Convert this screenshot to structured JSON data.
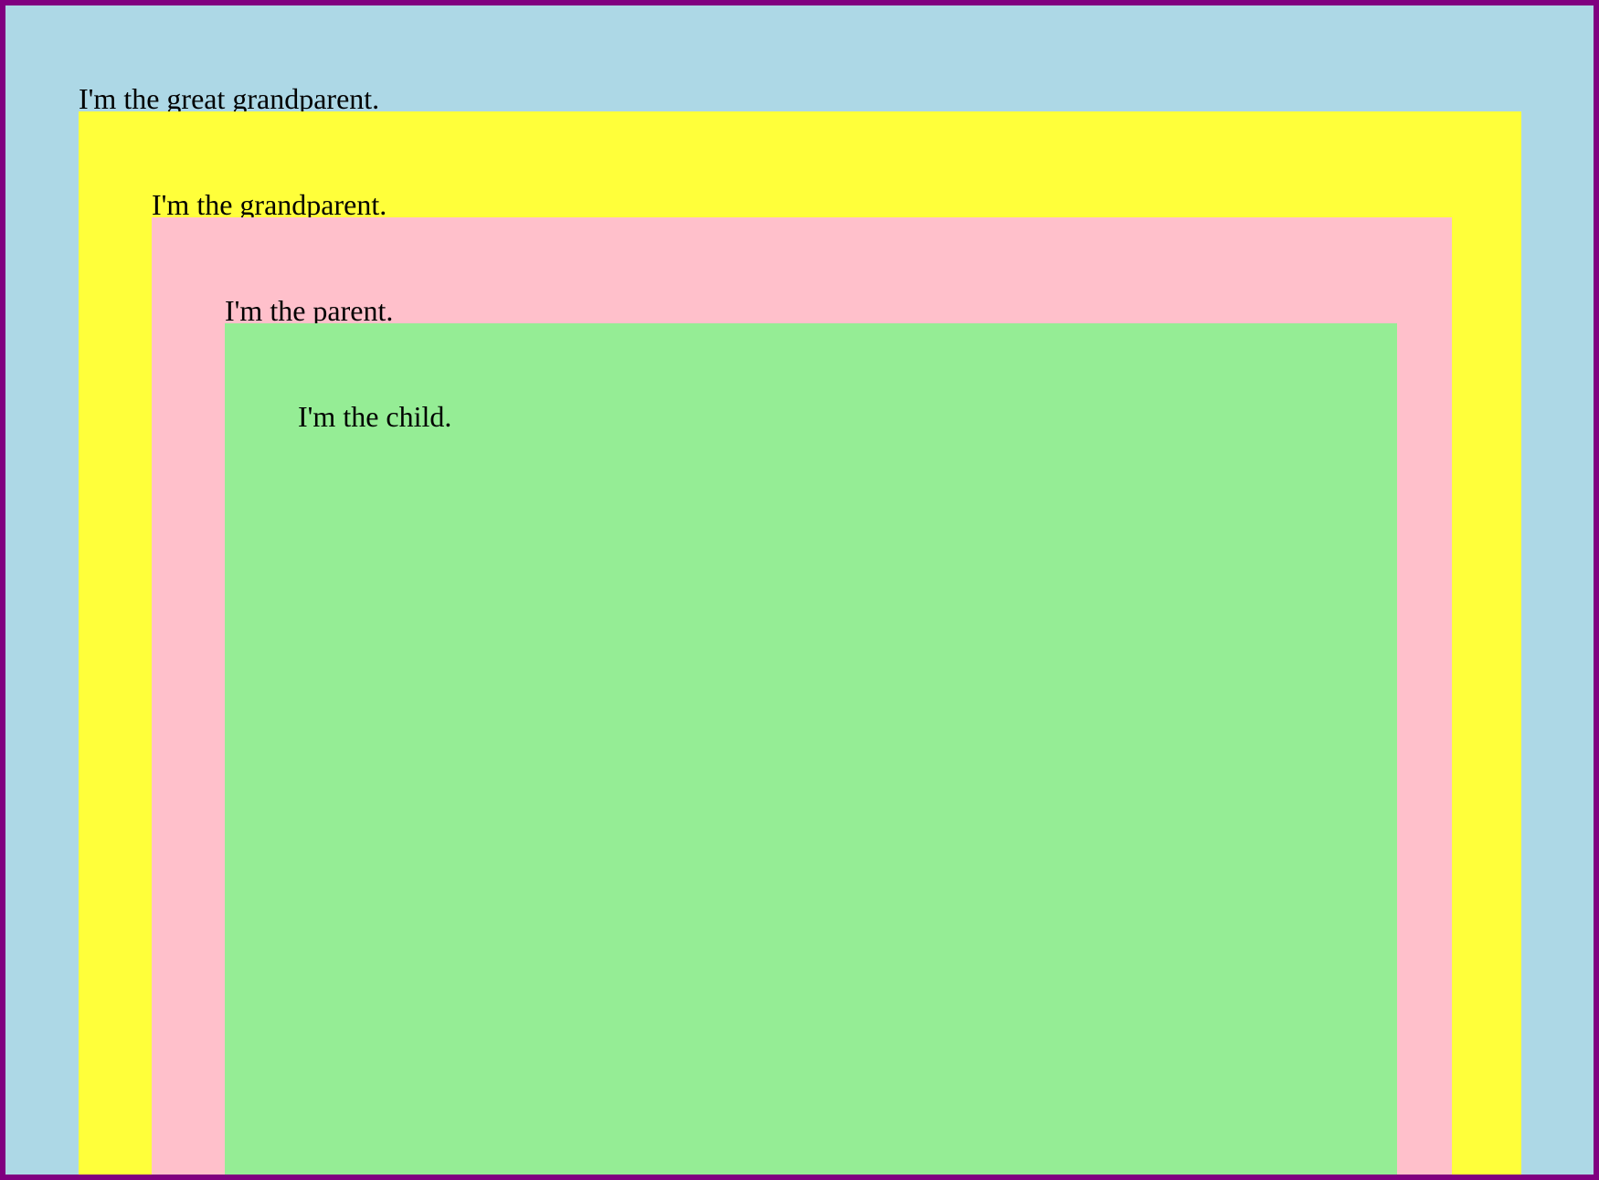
{
  "colors": {
    "frame_border": "#800080",
    "great_grandparent_bg": "#add8e6",
    "grandparent_bg": "#ffff3a",
    "parent_bg": "#ffc0cb",
    "child_bg": "#95ed95"
  },
  "labels": {
    "great_grandparent": "I'm the great grandparent.",
    "grandparent": "I'm the grandparent.",
    "parent": "I'm the parent.",
    "child": "I'm the child."
  }
}
